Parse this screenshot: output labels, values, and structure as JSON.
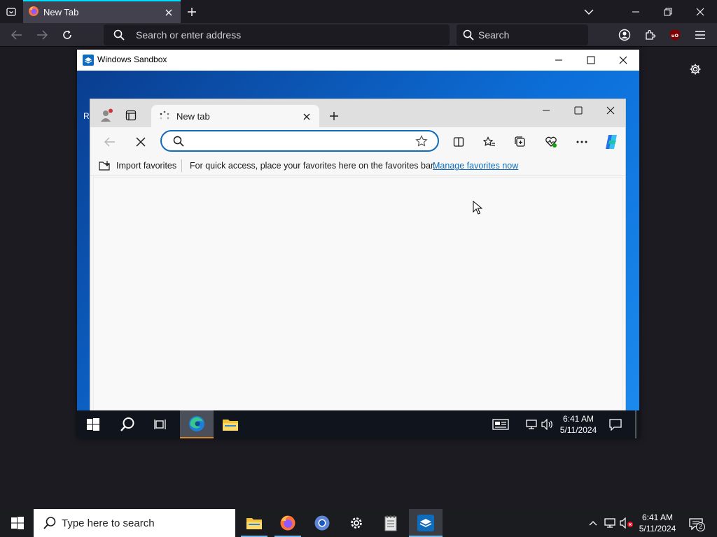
{
  "firefox": {
    "tab_title": "New Tab",
    "url_placeholder": "Search or enter address",
    "search_placeholder": "Search"
  },
  "sandbox": {
    "title": "Windows Sandbox",
    "edge": {
      "tab_title": "New tab",
      "omnibox_value": "",
      "import_favorites": "Import favorites",
      "favorites_hint": "For quick access, place your favorites here on the favorites bar.",
      "manage_favorites": "Manage favorites now"
    },
    "desktop_fragment": "R",
    "clock": {
      "time": "6:41 AM",
      "date": "5/11/2024"
    }
  },
  "host_taskbar": {
    "search_placeholder": "Type here to search",
    "clock": {
      "time": "6:41 AM",
      "date": "5/11/2024"
    },
    "notification_count": "2"
  }
}
